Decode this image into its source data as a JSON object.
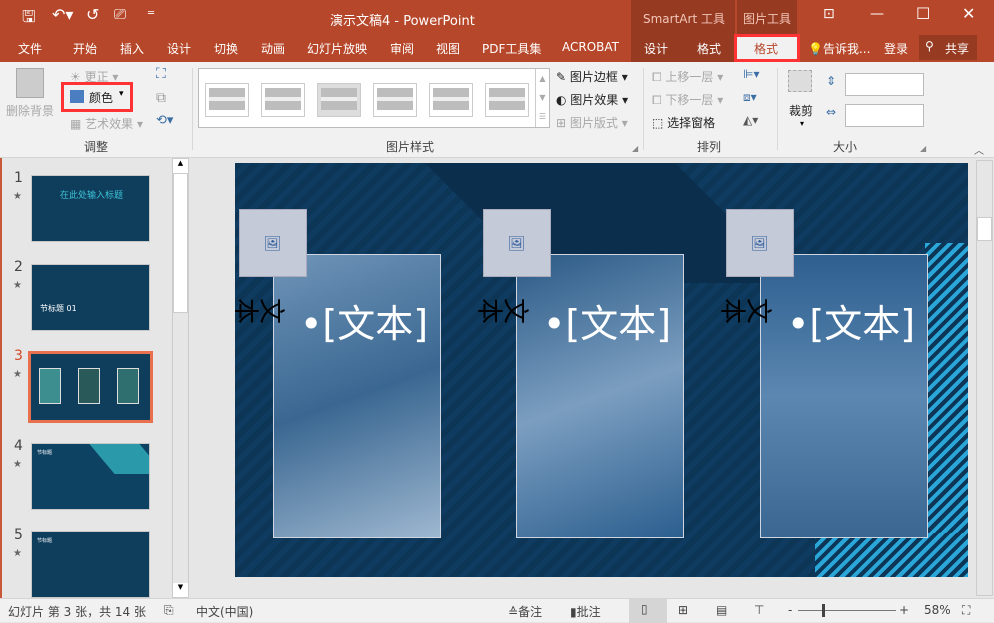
{
  "title_bar": {
    "qat_icons": [
      "save-icon",
      "undo-icon",
      "redo-icon",
      "present-icon",
      "customize-icon"
    ],
    "title": "演示文稿4 - PowerPoint",
    "context_groups": [
      "SmartArt 工具",
      "图片工具"
    ],
    "window_controls": [
      "ribbon-display-icon",
      "minimize-icon",
      "maximize-icon",
      "close-icon"
    ]
  },
  "tabs": [
    "文件",
    "开始",
    "插入",
    "设计",
    "切换",
    "动画",
    "幻灯片放映",
    "审阅",
    "视图",
    "PDF工具集",
    "ACROBAT",
    "设计",
    "格式",
    "格式"
  ],
  "active_tab": "格式",
  "tell_me": "告诉我...",
  "login": "登录",
  "share": "共享",
  "colors": {
    "accent": "#b7472a",
    "highlight": "#ff3333",
    "slide_bg": "#0c3556"
  },
  "ribbon": {
    "adjust": {
      "remove_bg": "删除背景",
      "corrections": "更正",
      "color": "颜色",
      "artistic": "艺术效果",
      "group": "调整"
    },
    "styles": {
      "group": "图片样式",
      "border": "图片边框",
      "effects": "图片效果",
      "layout": "图片版式"
    },
    "arrange": {
      "bring_forward": "上移一层",
      "send_backward": "下移一层",
      "selection_pane": "选择窗格",
      "group": "排列"
    },
    "size": {
      "crop": "裁剪",
      "height": "",
      "width": "",
      "group": "大小"
    }
  },
  "thumbnails": [
    {
      "num": "1",
      "text": "在此处输入标题"
    },
    {
      "num": "2",
      "text": "节标题 01"
    },
    {
      "num": "3",
      "text": ""
    },
    {
      "num": "4",
      "text": "节标题"
    },
    {
      "num": "5",
      "text": "节标题"
    }
  ],
  "current_slide": "3",
  "slide": {
    "columns": [
      {
        "bullet": "•[文本]",
        "vertical": "文本"
      },
      {
        "bullet": "•[文本]",
        "vertical": "文本"
      },
      {
        "bullet": "•[文本]",
        "vertical": "文本"
      }
    ]
  },
  "status": {
    "slide_info": "幻灯片 第 3 张，共 14 张",
    "language": "中文(中国)",
    "notes": "备注",
    "comments": "批注",
    "zoom": "58%",
    "zoom_level": 58
  }
}
